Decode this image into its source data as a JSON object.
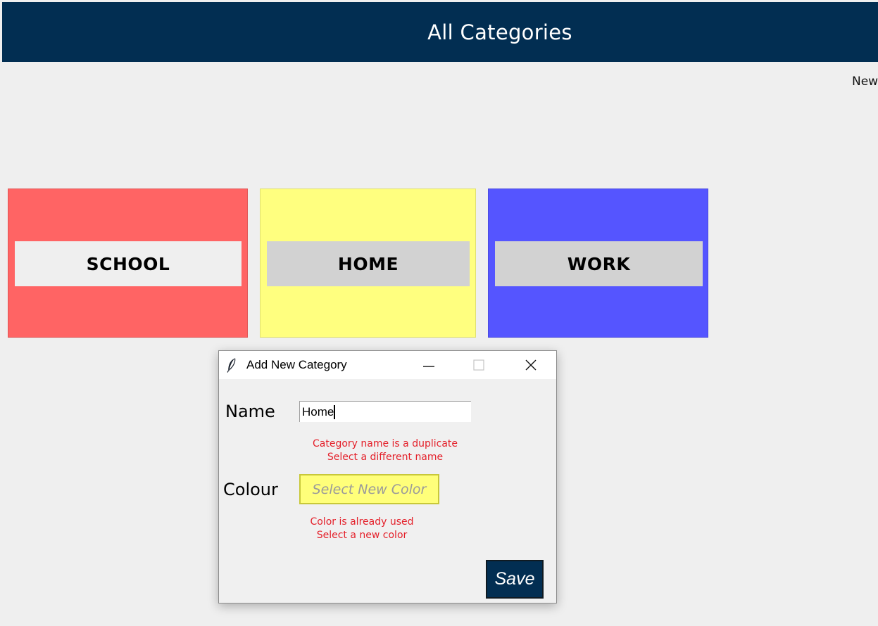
{
  "header": {
    "title": "All Categories",
    "background_color": "#022e52"
  },
  "top_right": {
    "new_label": "New"
  },
  "categories": [
    {
      "label": "SCHOOL",
      "color": "#ff6464",
      "selected": true
    },
    {
      "label": "HOME",
      "color": "#ffff7f",
      "selected": false
    },
    {
      "label": "WORK",
      "color": "#5555ff",
      "selected": false
    }
  ],
  "dialog": {
    "title": "Add New Category",
    "icon": "feather-icon",
    "controls": {
      "minimize": "minimize-icon",
      "maximize": "maximize-icon",
      "close": "close-icon"
    },
    "name_label": "Name",
    "name_value": "Home",
    "name_error_line1": "Category name is a duplicate",
    "name_error_line2": "Select a different name",
    "colour_label": "Colour",
    "color_button_text": "Select New Color",
    "selected_color": "#ffff7a",
    "color_error_line1": "Color is already used",
    "color_error_line2": "Select a new color",
    "save_label": "Save",
    "error_color": "#e4202a"
  }
}
